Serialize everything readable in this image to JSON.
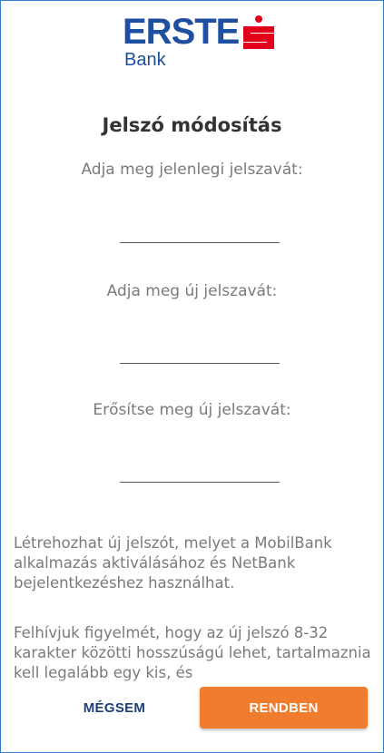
{
  "logo": {
    "word": "ERSTE",
    "sub": "Bank",
    "mark_icon": "erste-s-mark-icon",
    "brand_color": "#1e4fa0",
    "mark_color": "#e2001a"
  },
  "dialog": {
    "title": "Jelszó módosítás",
    "fields": [
      {
        "label": "Adja meg jelenlegi jelszavát:",
        "value": ""
      },
      {
        "label": "Adja meg új jelszavát:",
        "value": ""
      },
      {
        "label": "Erősítse meg új jelszavát:",
        "value": ""
      }
    ],
    "info": [
      "Létrehozhat új jelszót, melyet a MobilBank alkalmazás aktiválásához és NetBank bejelentkezéshez használhat.",
      "Felhívjuk figyelmét, hogy az új jelszó 8-32 karakter közötti hosszúságú lehet, tartalmaznia kell legalább egy kis, és"
    ]
  },
  "actions": {
    "cancel_label": "MÉGSEM",
    "ok_label": "RENDBEN",
    "accent_color": "#f07c2e"
  }
}
